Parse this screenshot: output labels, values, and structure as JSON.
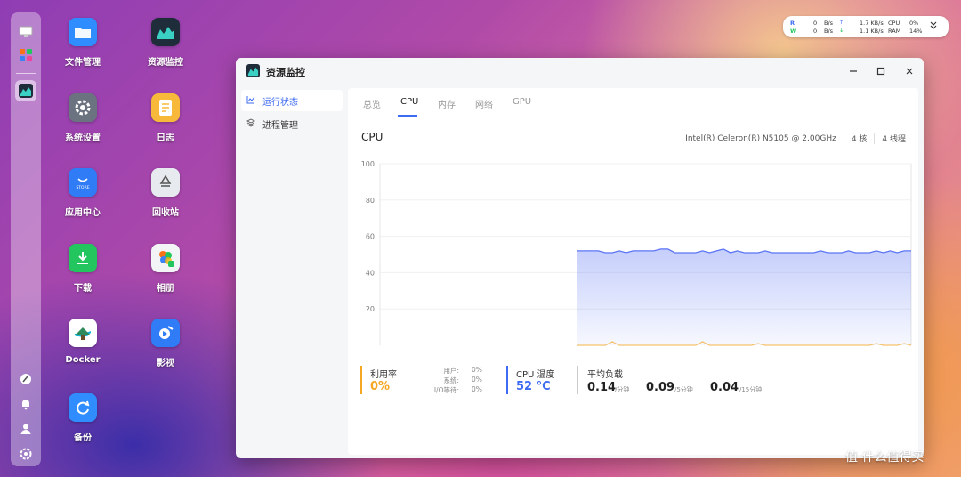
{
  "desktop": {
    "icons": [
      {
        "label": "文件管理",
        "icon": "folder-icon",
        "color": "#2f8dff"
      },
      {
        "label": "资源监控",
        "icon": "monitor-icon",
        "color": "#1f2d3a"
      },
      {
        "label": "系统设置",
        "icon": "gear-icon",
        "color": "#6b7280"
      },
      {
        "label": "日志",
        "icon": "log-icon",
        "color": "#f8b93a"
      },
      {
        "label": "应用中心",
        "icon": "store-icon",
        "color": "#2f7cf6",
        "sub": "STORE"
      },
      {
        "label": "回收站",
        "icon": "recycle-icon",
        "color": "#e7eaee"
      },
      {
        "label": "下载",
        "icon": "download-icon",
        "color": "#22c55e"
      },
      {
        "label": "相册",
        "icon": "photos-icon",
        "color": "#f3f4f6"
      },
      {
        "label": "Docker",
        "icon": "docker-icon",
        "color": "#ffffff"
      },
      {
        "label": "影视",
        "icon": "video-icon",
        "color": "#2f7cf6"
      },
      {
        "label": "备份",
        "icon": "backup-icon",
        "color": "#2f8dff"
      }
    ]
  },
  "status": {
    "r_label": "R",
    "w_label": "W",
    "r_val": "0",
    "w_val": "0",
    "unit": "B/s",
    "net_up": "1.7 KB/s",
    "net_down": "1.1 KB/s",
    "cpu_label": "CPU",
    "cpu_val": "0%",
    "ram_label": "RAM",
    "ram_val": "14%"
  },
  "window": {
    "title": "资源监控",
    "sidebar": [
      {
        "label": "运行状态"
      },
      {
        "label": "进程管理"
      }
    ],
    "tabs": [
      "总览",
      "CPU",
      "内存",
      "网络",
      "GPU"
    ],
    "cpu": {
      "heading": "CPU",
      "model": "Intel(R) Celeron(R) N5105 @ 2.00GHz",
      "cores": "4 核",
      "threads": "4 线程"
    },
    "metrics": {
      "usage_label": "利用率",
      "usage_value": "0%",
      "user_label": "用户:",
      "user_value": "0%",
      "sys_label": "系统:",
      "sys_value": "0%",
      "io_label": "I/O等待:",
      "io_value": "0%",
      "temp_label": "CPU 温度",
      "temp_value": "52 °C",
      "load_label": "平均负载",
      "load1": "0.14",
      "load1_unit": "/分钟",
      "load5": "0.09",
      "load5_unit": "/5分钟",
      "load15": "0.04",
      "load15_unit": "/15分钟"
    },
    "colors": {
      "accent": "#3d6bf2",
      "usage": "#f5a623",
      "temp": "#3d6bf2",
      "load_line": "#f5c16c"
    }
  },
  "watermark": "值 什么值得买",
  "chart_data": {
    "type": "area",
    "ylim": [
      0,
      100
    ],
    "yticks": [
      "100",
      "80",
      "60",
      "40",
      "20"
    ],
    "series": [
      {
        "values": [
          52,
          52,
          52,
          52,
          51,
          51,
          52,
          51,
          52,
          52,
          52,
          52,
          53,
          53,
          51,
          51,
          51,
          51,
          52,
          51,
          52,
          53,
          51,
          52,
          51,
          51,
          51,
          52,
          51,
          51,
          51,
          51,
          51,
          51,
          51,
          52,
          51,
          51,
          51,
          52,
          51,
          51,
          51,
          52,
          51,
          52,
          51,
          52,
          52
        ]
      },
      {
        "values": [
          0,
          0,
          0,
          0,
          0,
          2,
          0,
          0,
          0,
          0,
          0,
          0,
          0,
          0,
          0,
          0,
          0,
          0,
          2,
          0,
          0,
          0,
          0,
          0,
          0,
          0,
          1,
          0,
          0,
          0,
          0,
          0,
          0,
          0,
          0,
          0,
          0,
          0,
          0,
          0,
          0,
          0,
          0,
          1,
          0,
          0,
          0,
          1,
          0
        ]
      }
    ]
  }
}
